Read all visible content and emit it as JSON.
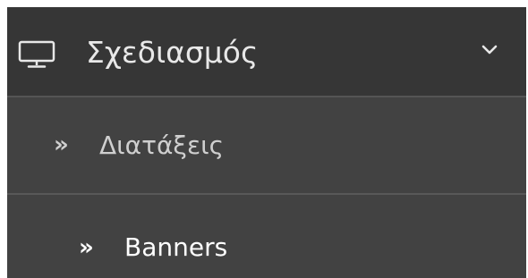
{
  "menu": {
    "section": {
      "title": "Σχεδιασμός",
      "icon": "monitor-icon",
      "expanded": true
    },
    "items": [
      {
        "label": "Διατάξεις",
        "icon": "double-chevron-right-icon",
        "glyph": "»"
      },
      {
        "label": "Banners",
        "icon": "double-chevron-right-icon",
        "glyph": "»"
      }
    ]
  },
  "colors": {
    "header_bg": "#363636",
    "item_bg": "#424242",
    "divider": "#555555",
    "text": "#ffffff"
  }
}
